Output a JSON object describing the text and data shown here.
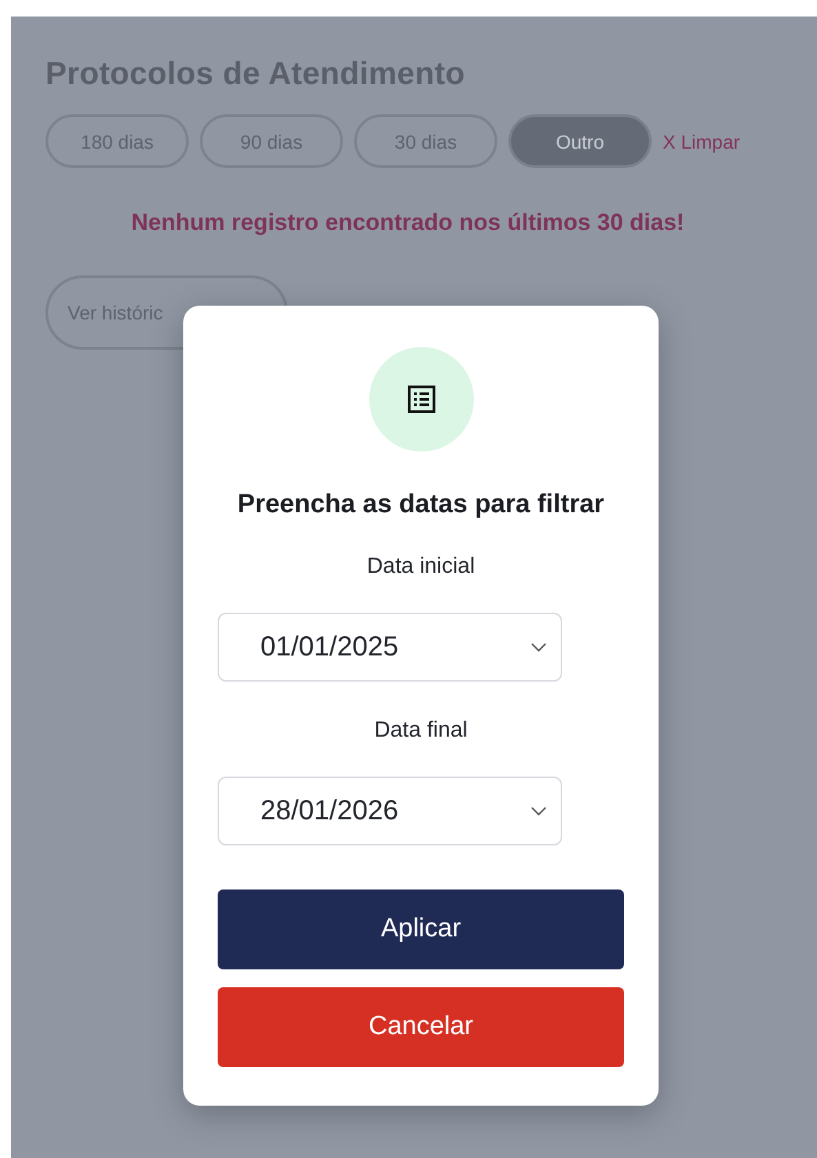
{
  "page": {
    "title": "Protocolos de Atendimento",
    "filters": [
      {
        "label": "180 dias",
        "selected": false
      },
      {
        "label": "90 dias",
        "selected": false
      },
      {
        "label": "30 dias",
        "selected": false
      },
      {
        "label": "Outro",
        "selected": true
      }
    ],
    "clear_link": "X Limpar",
    "empty_message": "Nenhum registro encontrado nos últimos 30 dias!",
    "history_button": "Ver históric"
  },
  "modal": {
    "title": "Preencha as datas para filtrar",
    "fields": [
      {
        "label": "Data inicial",
        "value": "01/01/2025"
      },
      {
        "label": "Data final",
        "value": "28/01/2026"
      }
    ],
    "buttons": [
      {
        "label": "Aplicar",
        "kind": "primary"
      },
      {
        "label": "Cancelar",
        "kind": "danger"
      }
    ]
  }
}
